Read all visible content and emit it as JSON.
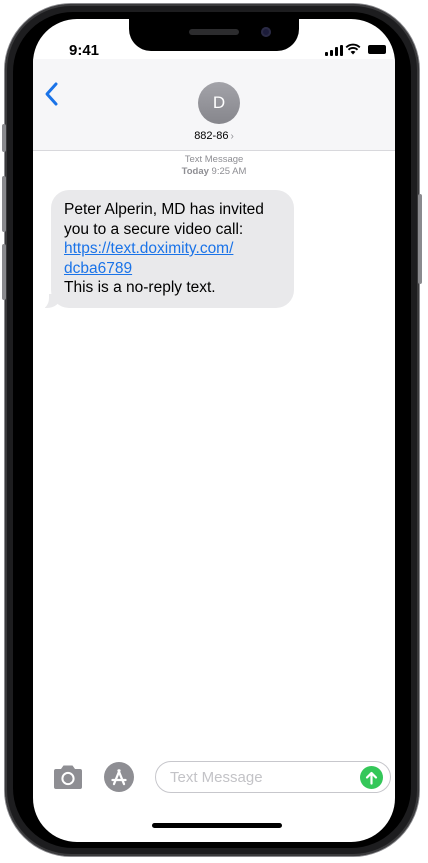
{
  "status_bar": {
    "time": "9:41"
  },
  "header": {
    "avatar_initial": "D",
    "contact_name": "882-86",
    "contact_chevron": "›",
    "back_icon": "chevron-left-icon"
  },
  "thread": {
    "service_label": "Text Message",
    "timestamp_day": "Today",
    "timestamp_time": "9:25 AM",
    "message": {
      "line1": "Peter Alperin, MD has invited",
      "line2": "you to a secure video call:",
      "link_line1": "https://text.doximity.com/",
      "link_line2": "dcba6789",
      "line3": "This is a no-reply text."
    }
  },
  "composer": {
    "placeholder": "Text Message",
    "camera_icon": "camera-icon",
    "apps_icon": "app-store-icon",
    "send_icon": "arrow-up-icon",
    "send_color": "#34c759"
  },
  "colors": {
    "accent": "#1a73e8",
    "bubble": "#e9e9eb"
  }
}
